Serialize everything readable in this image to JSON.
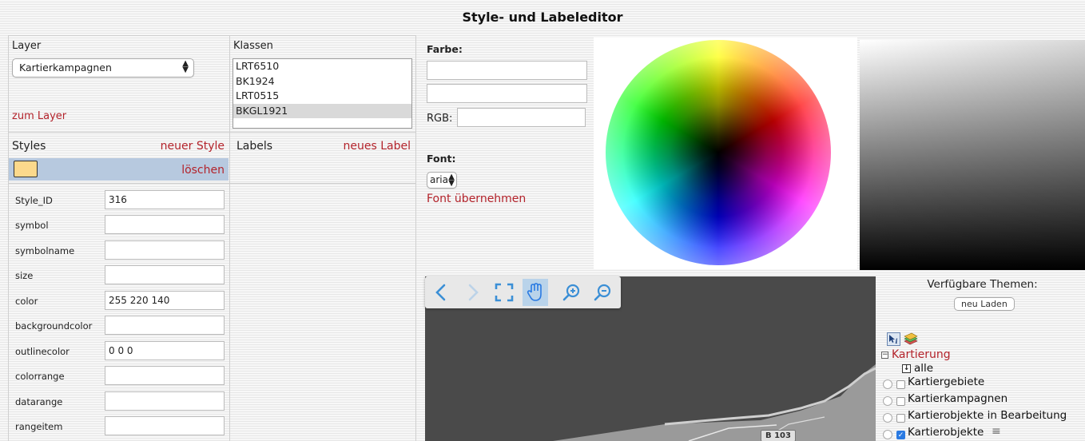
{
  "title": "Style- und Labeleditor",
  "layer": {
    "label": "Layer",
    "selected": "Kartierkampagnen",
    "link": "zum Layer"
  },
  "klassen": {
    "label": "Klassen",
    "items": [
      "LRT6510",
      "BK1924",
      "LRT0515",
      "BKGL1921"
    ],
    "selected_index": 3
  },
  "styles": {
    "label": "Styles",
    "new_link": "neuer Style",
    "delete_link": "löschen",
    "swatch_color": "#fcd98c"
  },
  "labels": {
    "label": "Labels",
    "new_link": "neues Label"
  },
  "properties": [
    {
      "name": "Style_ID",
      "value": "316"
    },
    {
      "name": "symbol",
      "value": ""
    },
    {
      "name": "symbolname",
      "value": ""
    },
    {
      "name": "size",
      "value": ""
    },
    {
      "name": "color",
      "value": "255 220 140"
    },
    {
      "name": "backgroundcolor",
      "value": ""
    },
    {
      "name": "outlinecolor",
      "value": "0 0 0"
    },
    {
      "name": "colorrange",
      "value": ""
    },
    {
      "name": "datarange",
      "value": ""
    },
    {
      "name": "rangeitem",
      "value": ""
    }
  ],
  "farbe": {
    "label": "Farbe:",
    "rgb_label": "RGB:"
  },
  "font": {
    "label": "Font:",
    "selected": "arial",
    "apply_link": "Font übernehmen"
  },
  "map": {
    "tools": [
      "back-icon",
      "forward-icon",
      "full-extent-icon",
      "pan-icon",
      "zoom-in-icon",
      "zoom-out-icon"
    ],
    "road_label": "B 103"
  },
  "themes": {
    "title": "Verfügbare Themen:",
    "reload_button": "neu Laden",
    "group": "Kartierung",
    "all_label": "alle",
    "layers": [
      {
        "name": "Kartiergebiete",
        "checked": false
      },
      {
        "name": "Kartierkampagnen",
        "checked": false
      },
      {
        "name": "Kartierobjekte in Bearbeitung",
        "checked": false
      },
      {
        "name": "Kartierobjekte",
        "checked": true
      }
    ]
  }
}
